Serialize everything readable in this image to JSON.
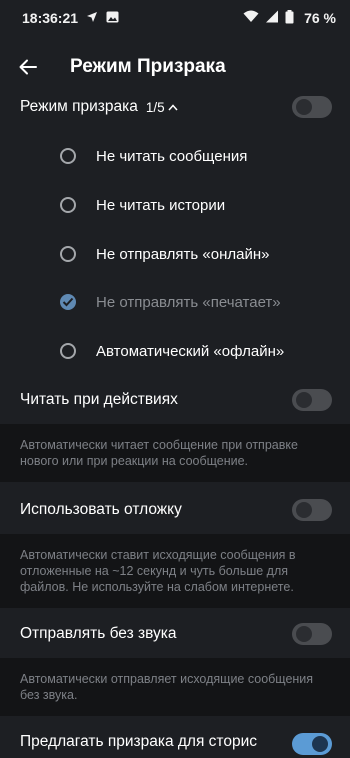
{
  "status": {
    "time": "18:36:21",
    "battery": "76 %"
  },
  "header": {
    "title": "Режим Призрака"
  },
  "ghost": {
    "label": "Режим призрака",
    "count": "1/5",
    "enabled": false,
    "options": [
      {
        "label": "Не читать сообщения",
        "checked": false
      },
      {
        "label": "Не читать истории",
        "checked": false
      },
      {
        "label": "Не отправлять «онлайн»",
        "checked": false
      },
      {
        "label": "Не отправлять «печатает»",
        "checked": true
      },
      {
        "label": "Автоматический «офлайн»",
        "checked": false
      }
    ]
  },
  "settings": [
    {
      "label": "Читать при действиях",
      "enabled": false,
      "description": "Автоматически читает сообщение при отправке нового или при реакции на сообщение."
    },
    {
      "label": "Использовать отложку",
      "enabled": false,
      "description": "Автоматически ставит исходящие сообщения в отложенные на ~12 секунд и чуть больше для файлов. Не используйте на слабом интернете."
    },
    {
      "label": "Отправлять без звука",
      "enabled": false,
      "description": "Автоматически отправляет исходящие сообщения без звука."
    },
    {
      "label": "Предлагать призрака для сторис",
      "enabled": true
    }
  ],
  "colors": {
    "background": "#1d1f23",
    "description_background": "#131416",
    "accent": "#5b9bd5"
  }
}
